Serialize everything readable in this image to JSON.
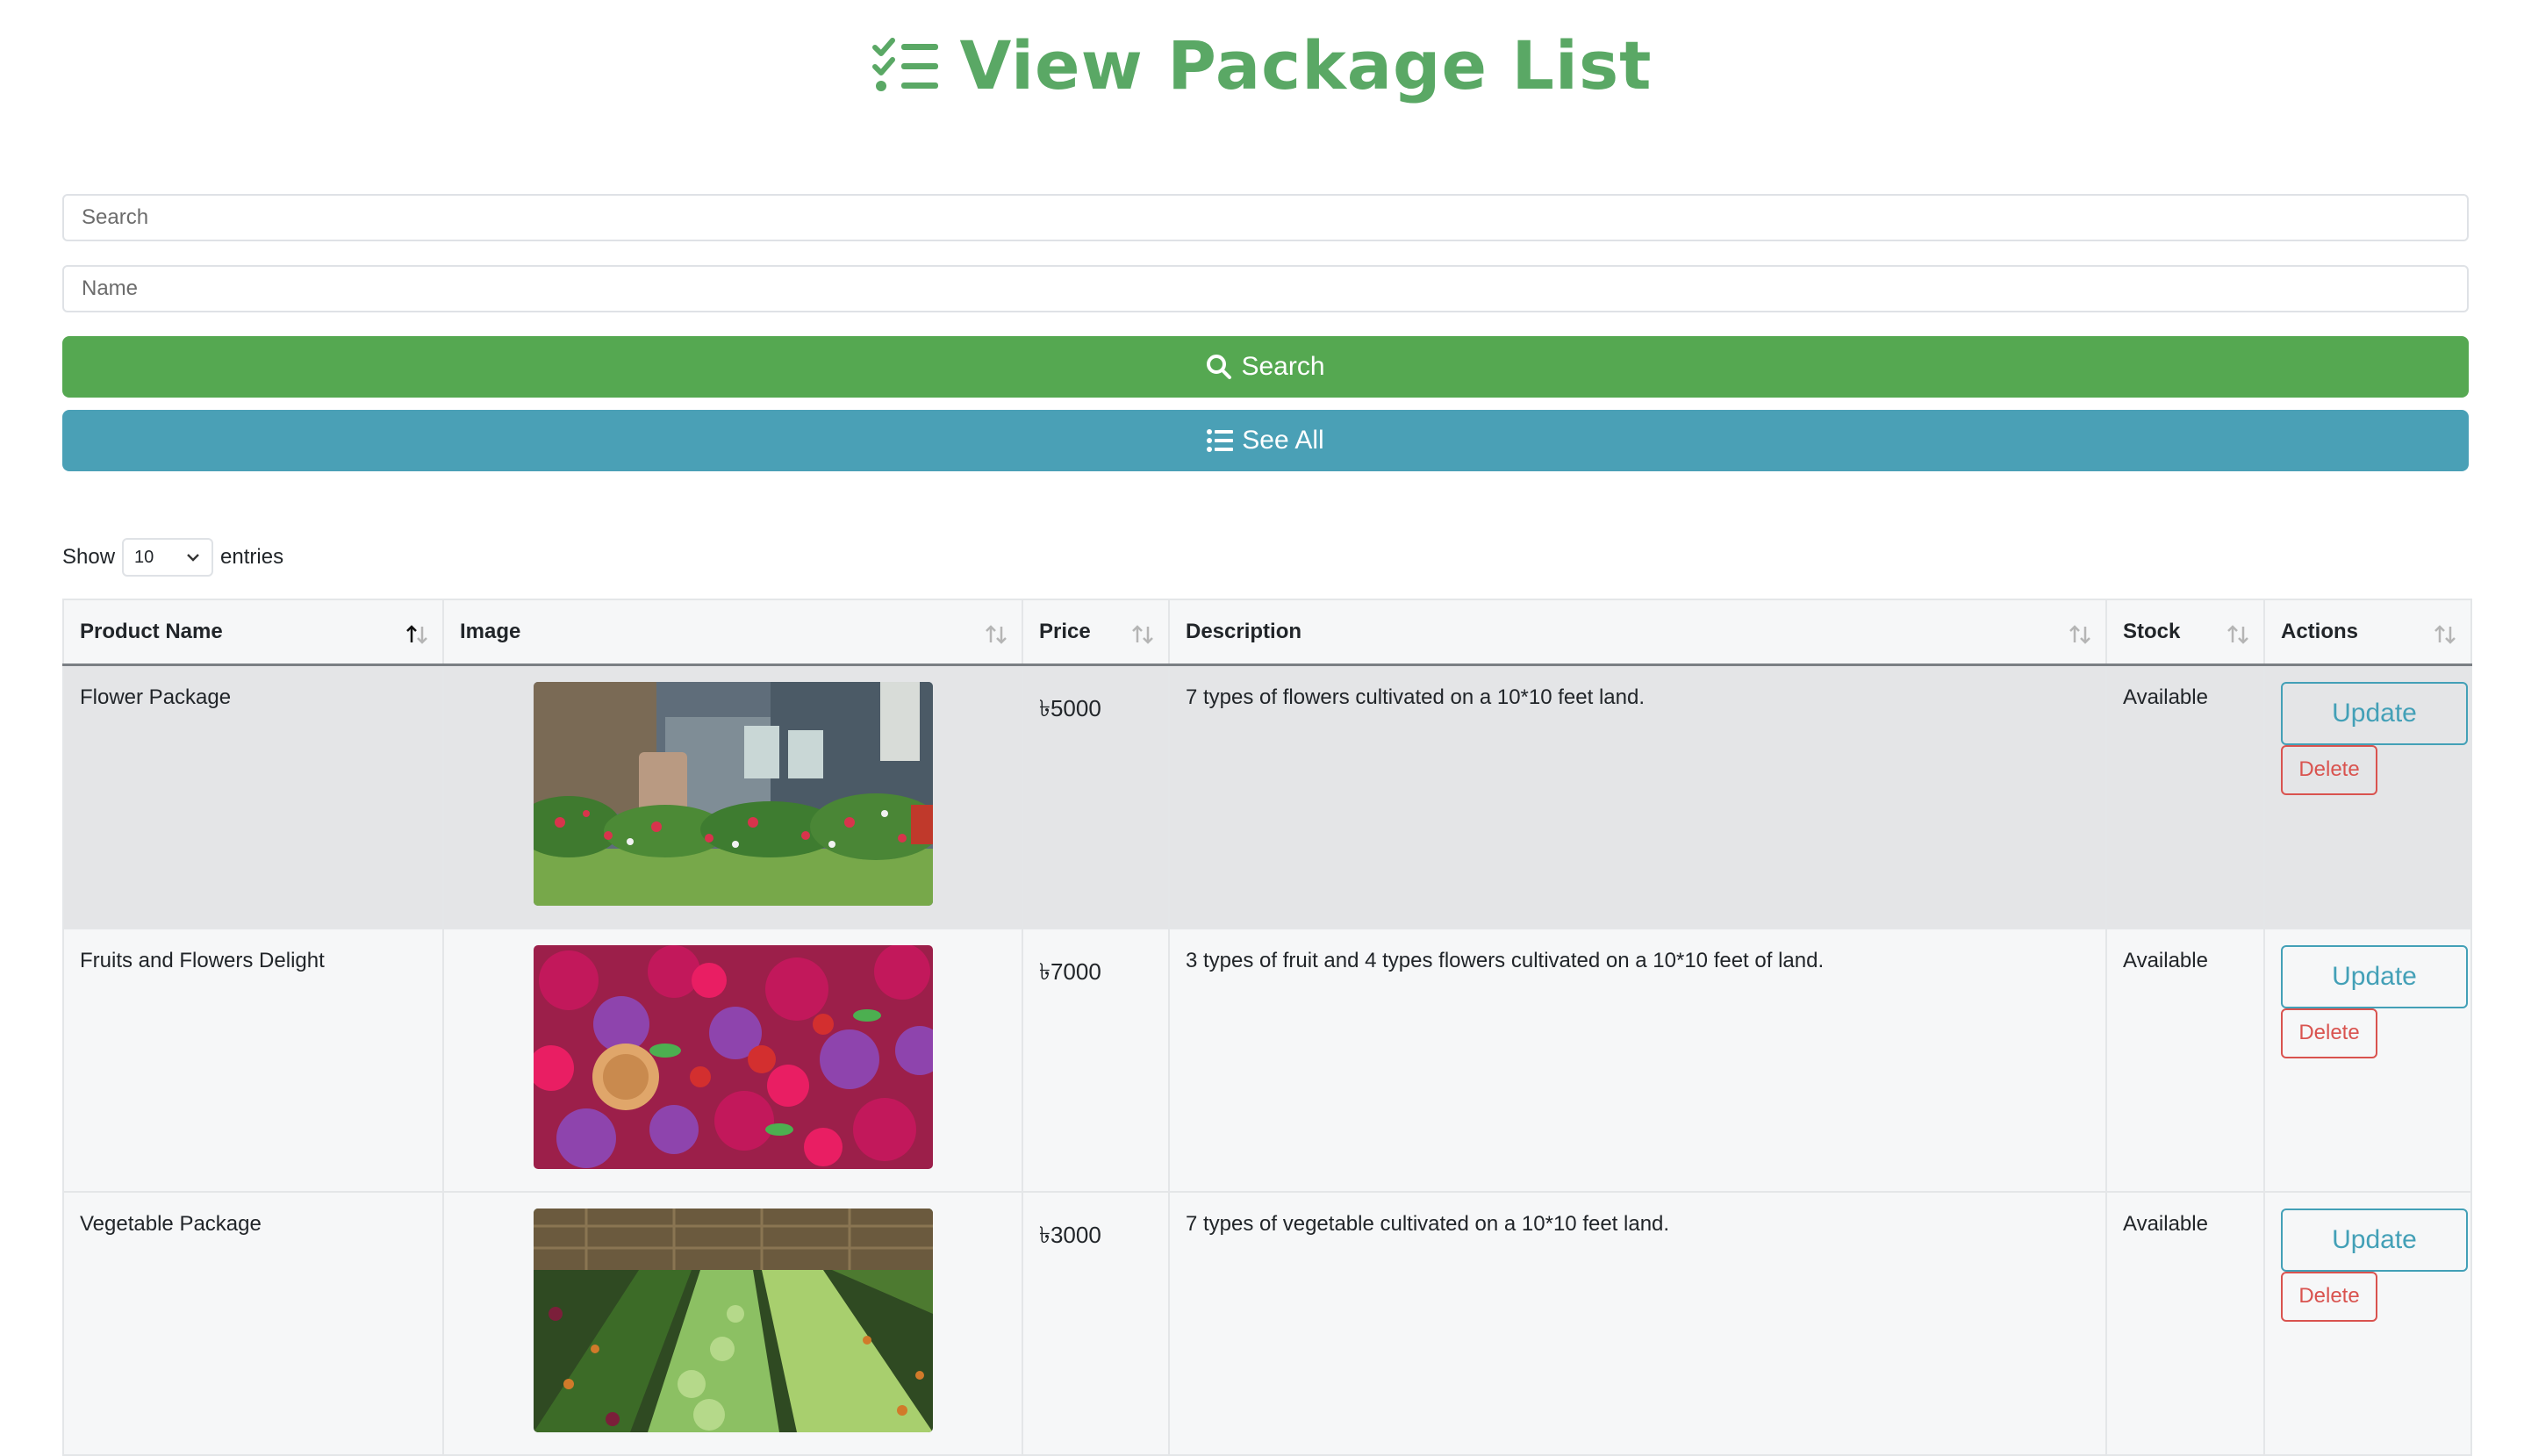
{
  "header": {
    "title": "View Package List",
    "icon": "list-check-icon",
    "color": "#5aa865"
  },
  "search": {
    "search_placeholder": "Search",
    "name_placeholder": "Name",
    "search_button": "Search",
    "see_all_button": "See All"
  },
  "length": {
    "show": "Show",
    "value": "10",
    "entries": "entries"
  },
  "table": {
    "columns": [
      "Product Name",
      "Image",
      "Price",
      "Description",
      "Stock",
      "Actions"
    ],
    "rows": [
      {
        "name": "Flower Package",
        "price": "৳5000",
        "description": "7 types of flowers cultivated on a 10*10 feet land.",
        "stock": "Available",
        "update": "Update",
        "delete": "Delete"
      },
      {
        "name": "Fruits and Flowers Delight",
        "price": "৳7000",
        "description": "3 types of fruit and 4 types flowers cultivated on a 10*10 feet of land.",
        "stock": "Available",
        "update": "Update",
        "delete": "Delete"
      },
      {
        "name": "Vegetable Package",
        "price": "৳3000",
        "description": "7 types of vegetable cultivated on a 10*10 feet land.",
        "stock": "Available",
        "update": "Update",
        "delete": "Delete"
      }
    ]
  },
  "colors": {
    "green": "#55a851",
    "teal": "#4aa0b6",
    "danger": "#d9534f"
  }
}
